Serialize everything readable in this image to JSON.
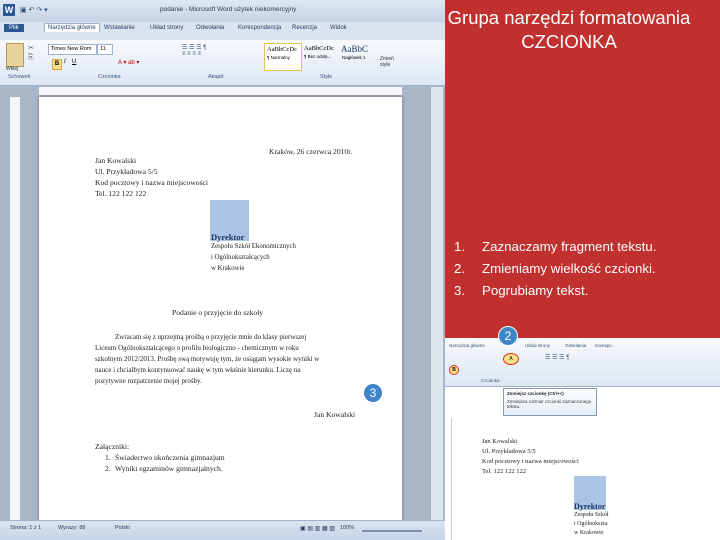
{
  "slide": {
    "title_line1": "Grupa narzędzi formatowania",
    "title_line2": "CZCIONKA",
    "steps": [
      {
        "num": "1.",
        "text": "Zaznaczamy fragment tekstu."
      },
      {
        "num": "2.",
        "text": "Zmieniamy wielkość czcionki."
      },
      {
        "num": "3.",
        "text": "Pogrubiamy tekst."
      }
    ],
    "badges": [
      "2",
      "3"
    ]
  },
  "word": {
    "window_title": "podanie - Microsoft Word użytek niekomercyjny",
    "tabs": [
      "Plik",
      "Narzędzia główne",
      "Wstawianie",
      "Układ strony",
      "Odwołania",
      "Korespondencja",
      "Recenzja",
      "Widok"
    ],
    "font_name": "Times New Rom",
    "font_size": "11",
    "group_labels": [
      "Schowek",
      "Czcionka",
      "Akapit",
      "Style"
    ],
    "styles": [
      {
        "preview": "AaBbCcDc",
        "label": "¶ Normalny"
      },
      {
        "preview": "AaBbCcDc",
        "label": "¶ Bez odstę..."
      },
      {
        "preview": "AaBbC",
        "label": "Nagłówek 1"
      }
    ],
    "change_styles": "Zmień style",
    "status": {
      "page": "Strona: 1 z 1",
      "words": "Wyrazy: 88",
      "lang": "Polski",
      "zoom": "100%"
    }
  },
  "document": {
    "date": "Kraków, 26 czerwca 2010r.",
    "sender": [
      "Jan Kowalski",
      "Ul. Przykładowa 5/5",
      "Kod pocztowy i nazwa miejscowości",
      "Tel. 122 122 122"
    ],
    "recipient_title": "Dyrektor",
    "recipient": [
      "Zespołu Szkół Ekonomicznych",
      "i Ogólnokształcących",
      "w Krakowie"
    ],
    "subject": "Podanie o przyjęcie do szkoły",
    "body": [
      "Zwracam się z uprzejmą prośbą o przyjęcie mnie do klasy pierwszej",
      "Liceum Ogólnokształcącego o profilu biologiczno - chemicznym w roku",
      "szkolnym 2012/2013. Prośbę swą motywuję tym, że osiągam wysokie wyniki w",
      "nauce i chciałbym kontynuować naukę w tym właśnie kierunku. Liczę na",
      "pozytywne rozpatrzenie mojej prośby."
    ],
    "signature": "Jan Kowalski",
    "attachments_label": "Załączniki:",
    "attachments": [
      {
        "num": "1.",
        "text": "Świadectwo ukończenia gimnazjum"
      },
      {
        "num": "2.",
        "text": "Wyniki egzaminów gimnazjalnych."
      }
    ]
  },
  "inset": {
    "tabs": [
      "Narzędzia główne",
      "Układ strony",
      "Odwołania",
      "Korespo"
    ],
    "group_label": "Czcionka",
    "tooltip_title": "Zmniejsz czcionkę (Ctrl+<)",
    "tooltip_text": "Zmniejsza rozmiar czcionki zaznaczonego tekstu.",
    "doc_lines": [
      "Jan Kowalski",
      "Ul. Przykładowa 5/5",
      "Kod pocztowy i nazwa miejscowości",
      "Tel. 122 122 122"
    ],
    "recipient_title": "Dyrektor",
    "recipient": [
      "Zespołu Szkół",
      "i Ogólnokszta",
      "w Krakowie"
    ]
  }
}
